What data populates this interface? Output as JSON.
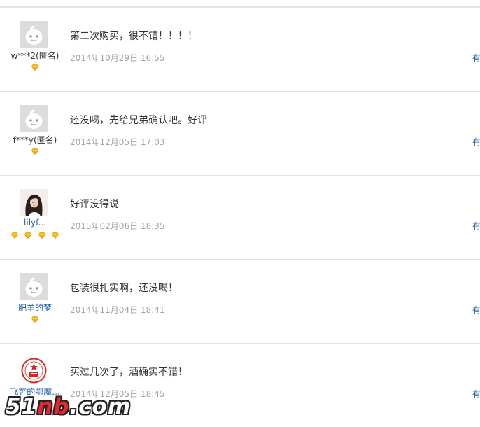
{
  "reviews": [
    {
      "user": "w***2(匿名)",
      "user_style": "anon",
      "avatar": "default-avatar",
      "diamonds": 1,
      "text": "第二次购买，很不错！！！！",
      "date": "2014年10月29日 16:55",
      "helpful": "有"
    },
    {
      "user": "f***y(匿名)",
      "user_style": "anon",
      "avatar": "default-avatar",
      "diamonds": 1,
      "text": "还没喝，先给兄弟确认吧。好评",
      "date": "2014年12月05日 17:03",
      "helpful": "有"
    },
    {
      "user": "lilyf...",
      "user_style": "link",
      "avatar": "photo-avatar",
      "diamonds": 4,
      "text": "好评没得说",
      "date": "2015年02月06日 18:35",
      "helpful": "有"
    },
    {
      "user": "肥羊的梦",
      "user_style": "link",
      "avatar": "default-avatar",
      "diamonds": 1,
      "text": "包装很扎实啊，还没喝！",
      "date": "2014年11月04日 18:41",
      "helpful": "有"
    },
    {
      "user": "飞奔的鄂魔...",
      "user_style": "link",
      "avatar": "seal-avatar",
      "diamonds": 0,
      "text": "买过几次了，酒确实不错！",
      "date": "2014年12月05日 18:45",
      "helpful": "有"
    }
  ],
  "watermark": {
    "prefix": "51",
    "accent": "nb",
    "suffix": ".com"
  },
  "colors": {
    "link": "#1f5fa8",
    "date": "#a3a3a3",
    "text": "#333333",
    "divider": "#e3e3e3",
    "diamond": "#f5b800"
  }
}
